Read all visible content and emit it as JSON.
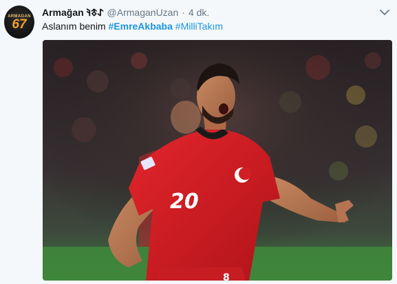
{
  "tweet": {
    "display_name": "Armağan 𐰀𐱃𐰚",
    "handle": "@ArmaganUzan",
    "separator": "·",
    "timestamp": "4 dk.",
    "text_prefix": "Aslanım benim ",
    "hashtag1_symbol": "#",
    "hashtag1": "EmreAkbaba",
    "hashtag2_symbol": "#",
    "hashtag2": "MilliTakım"
  },
  "avatar": {
    "name": "ARMAGAN",
    "number": "67"
  },
  "media": {
    "jersey_number": "20",
    "shorts_number": "8"
  },
  "icons": {
    "caret": "chevron-down-icon"
  },
  "colors": {
    "link": "#1b95e0",
    "text": "#14171a",
    "muted": "#657786",
    "background": "#f5f8fa"
  }
}
